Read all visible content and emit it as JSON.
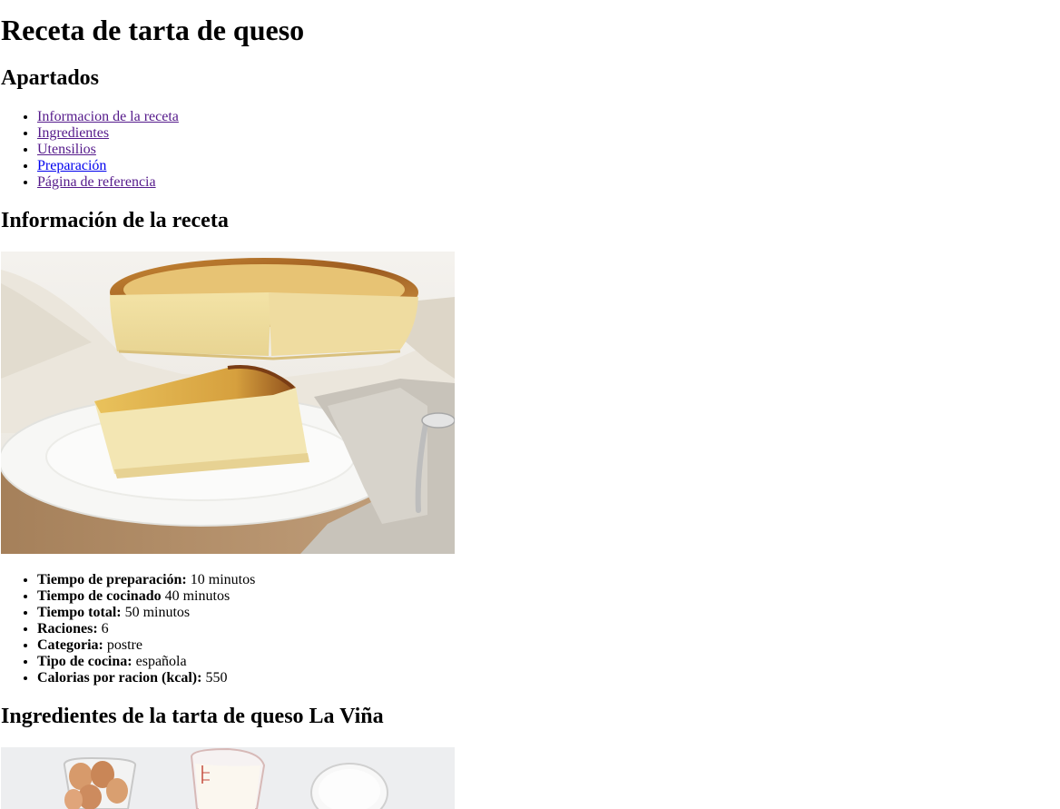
{
  "page_title": "Receta de tarta de queso",
  "sections_heading": "Apartados",
  "toc": [
    {
      "label": "Informacion de la receta",
      "visited": true
    },
    {
      "label": "Ingredientes",
      "visited": true
    },
    {
      "label": "Utensilios",
      "visited": true
    },
    {
      "label": "Preparación",
      "visited": false
    },
    {
      "label": "Página de referencia",
      "visited": true
    }
  ],
  "info_heading": "Información de la receta",
  "info": [
    {
      "label": "Tiempo de preparación:",
      "value": " 10 minutos"
    },
    {
      "label": "Tiempo de cocinado",
      "value": " 40 minutos"
    },
    {
      "label": "Tiempo total:",
      "value": " 50 minutos"
    },
    {
      "label": "Raciones:",
      "value": " 6"
    },
    {
      "label": "Categoria:",
      "value": " postre"
    },
    {
      "label": "Tipo de cocina:",
      "value": " española"
    },
    {
      "label": "Calorias por racion (kcal):",
      "value": " 550"
    }
  ],
  "ingredients_heading": "Ingredientes de la tarta de queso La Viña",
  "colors": {
    "link_visited": "#551a8b",
    "link_unvisited": "#0000ee"
  }
}
